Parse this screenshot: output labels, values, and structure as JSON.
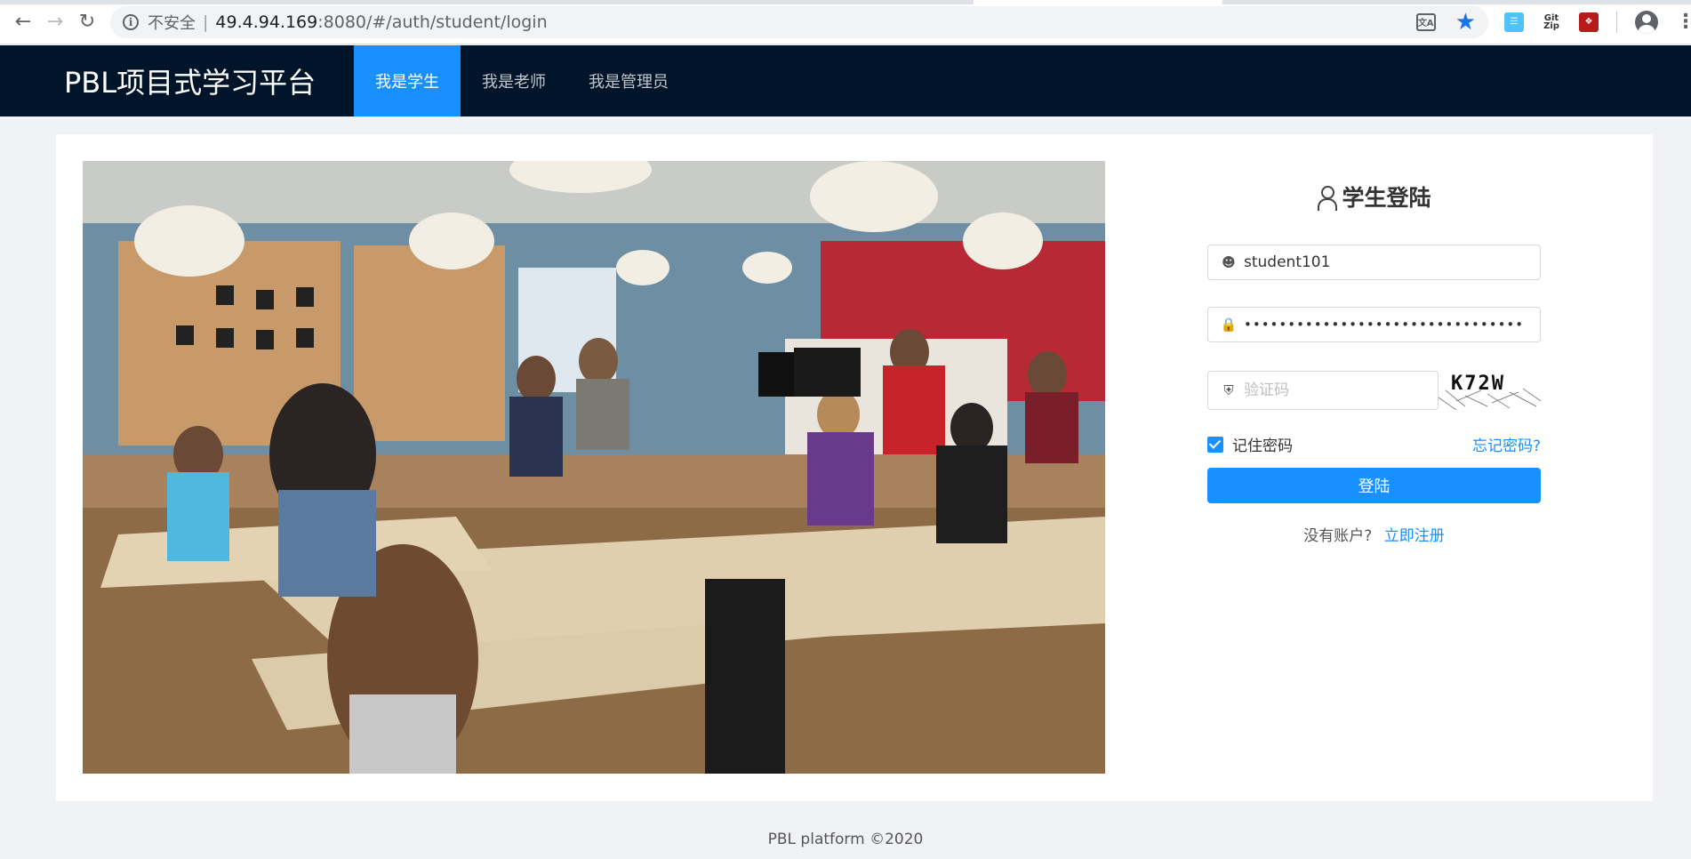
{
  "browser": {
    "insecure_label": "不安全",
    "separator": "|",
    "url_host": "49.4.94.169",
    "url_rest": ":8080/#/auth/student/login",
    "extensions": [
      "translate-icon",
      "bookmark-star-icon",
      "doc-extension-icon",
      "gitzip-extension-icon",
      "pdf-extension-icon"
    ],
    "gitzip_label": "Git Zip"
  },
  "header": {
    "logo": "PBL项目式学习平台",
    "nav": [
      {
        "label": "我是学生",
        "active": true
      },
      {
        "label": "我是老师",
        "active": false
      },
      {
        "label": "我是管理员",
        "active": false
      }
    ],
    "colors": {
      "bar": "#001529",
      "active": "#1890ff"
    }
  },
  "login": {
    "title": "学生登陆",
    "username_value": "student101",
    "password_mask": "••••••••••••••••••••••••••••••••",
    "captcha_placeholder": "验证码",
    "captcha_text": "K72W",
    "remember_label": "记住密码",
    "remember_checked": true,
    "forgot_link": "忘记密码?",
    "submit_label": "登陆",
    "no_account_text": "没有账户?",
    "register_link": "立即注册"
  },
  "footer": {
    "text": "PBL platform ©2020"
  }
}
